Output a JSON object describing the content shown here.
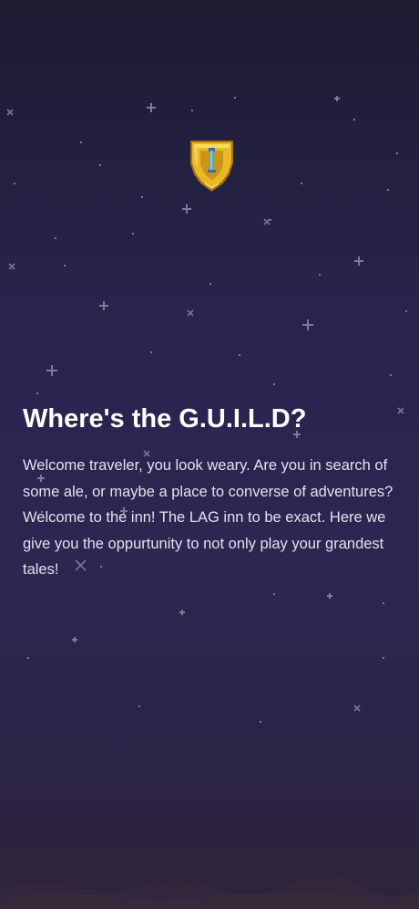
{
  "screen": {
    "logo": "shield-icon",
    "title": "Where's the G.U.I.L.D?",
    "body": "Welcome traveler, you look weary. Are you in search of some ale, or maybe a place to converse of adventures? Welcome to the inn! The LAG inn to be exact. Here we give you the oppurtunity to not only play your grandest tales!"
  },
  "colors": {
    "background_top": "#1c1b31",
    "background_mid": "#2a2550",
    "background_bottom": "#2f2538",
    "text": "#ffffff",
    "shield_gold": "#e8b923",
    "shield_blue": "#3aa6e6"
  }
}
